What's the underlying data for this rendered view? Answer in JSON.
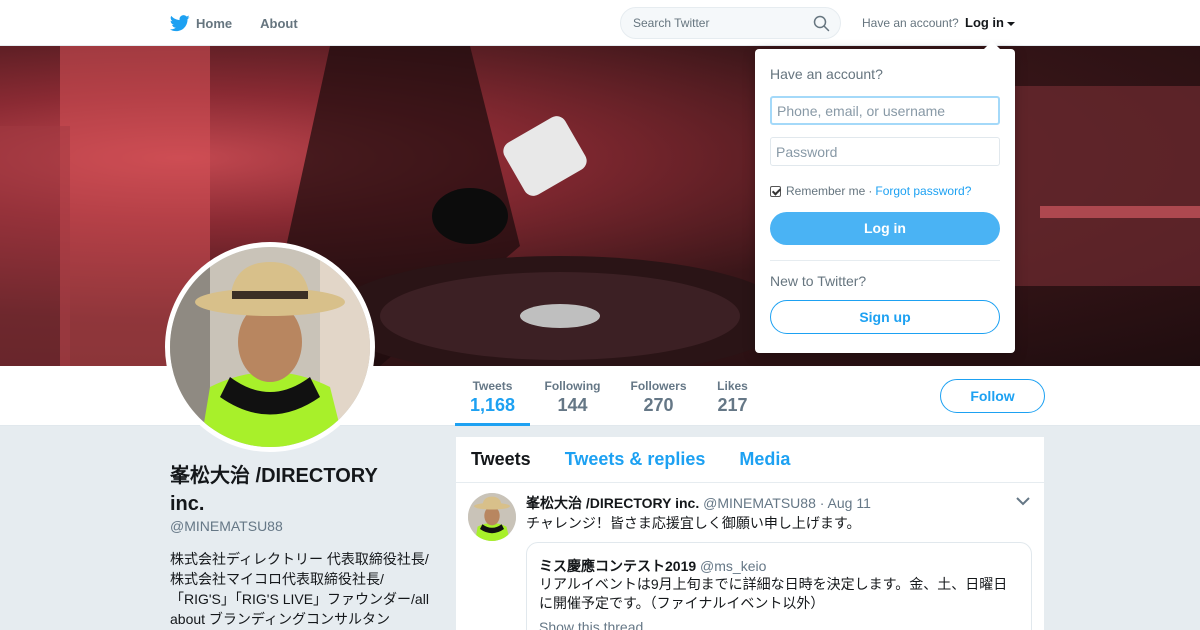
{
  "nav": {
    "home_label": "Home",
    "about_label": "About",
    "search_placeholder": "Search Twitter",
    "have_account": "Have an account?",
    "login_label": "Log in"
  },
  "profile": {
    "name": "峯松大治 /DIRECTORY inc.",
    "handle": "@MINEMATSU88",
    "bio": "株式会社ディレクトリー 代表取締役社長/株式会社マイコロ代表取締役社長/「RIG'S」「RIG'S LIVE」ファウンダー/all about ブランディングコンサルタン"
  },
  "stats": [
    {
      "label": "Tweets",
      "value": "1,168"
    },
    {
      "label": "Following",
      "value": "144"
    },
    {
      "label": "Followers",
      "value": "270"
    },
    {
      "label": "Likes",
      "value": "217"
    }
  ],
  "follow_label": "Follow",
  "timeline": {
    "tabs": [
      "Tweets",
      "Tweets & replies",
      "Media"
    ],
    "tweet": {
      "name": "峯松大治 /DIRECTORY inc.",
      "handle": "@MINEMATSU88",
      "date": "Aug 11",
      "text": "チャレンジ！皆さま応援宜しく御願い申し上げます。",
      "quote": {
        "name": "ミス慶應コンテスト2019",
        "handle": "@ms_keio",
        "text": "リアルイベントは9月上旬までに詳細な日時を決定します。金、土、日曜日に開催予定です。（ファイナルイベント以外）",
        "more": "Show this thread"
      }
    }
  },
  "login_dropdown": {
    "title": "Have an account?",
    "username_placeholder": "Phone, email, or username",
    "password_placeholder": "Password",
    "remember": "Remember me",
    "separator": "·",
    "forgot": "Forgot password?",
    "login_button": "Log in",
    "new_to": "New to Twitter?",
    "signup_button": "Sign up"
  },
  "colors": {
    "accent": "#1da1f2",
    "login_button": "#4ab3f4",
    "background": "#e6ecf0"
  }
}
